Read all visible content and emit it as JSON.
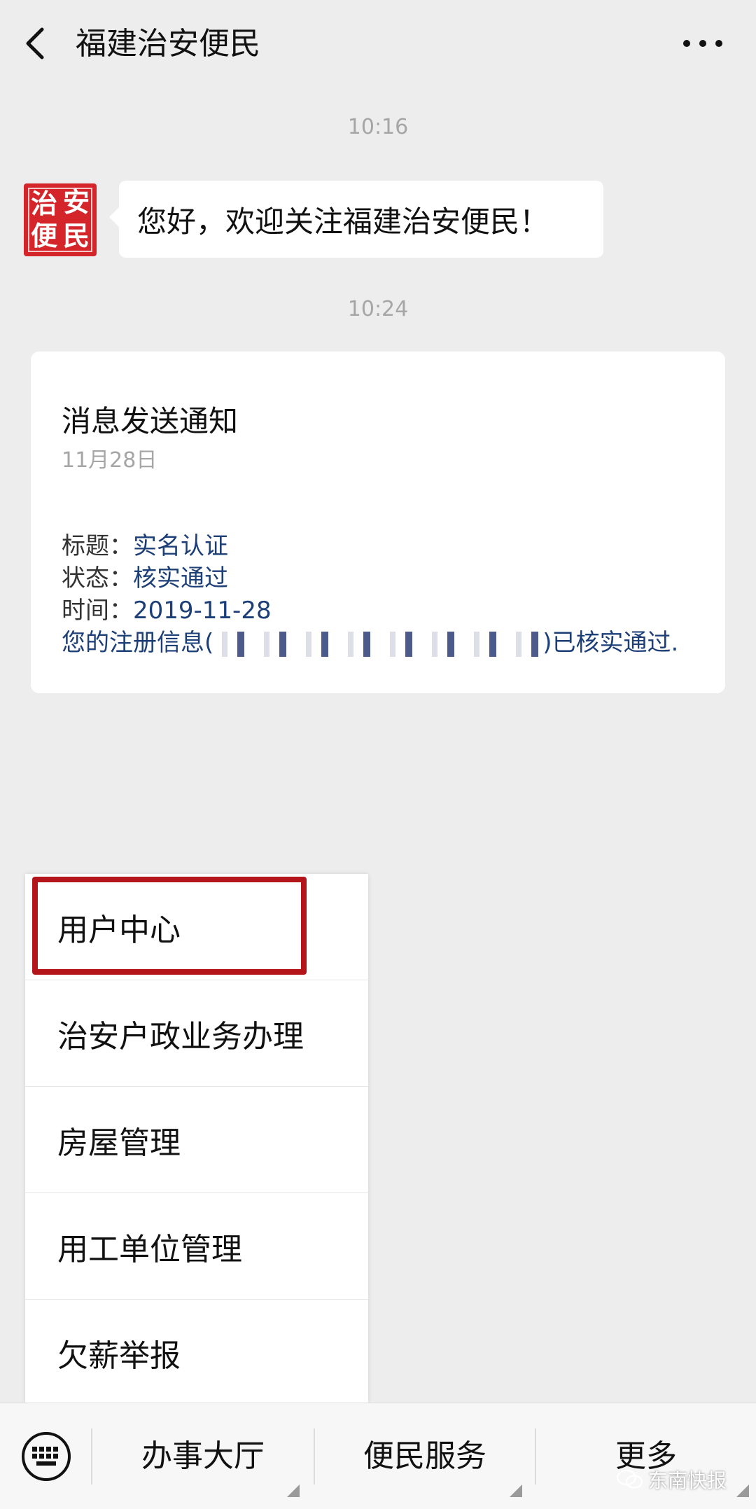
{
  "header": {
    "title": "福建治安便民"
  },
  "chat": {
    "time1": "10:16",
    "avatar_chars": [
      "治",
      "安",
      "便",
      "民"
    ],
    "greeting": "您好，欢迎关注福建治安便民！",
    "time2": "10:24",
    "card": {
      "title": "消息发送通知",
      "date": "11月28日",
      "rows": [
        {
          "label": "标题：",
          "value": "实名认证"
        },
        {
          "label": "状态：",
          "value": "核实通过"
        },
        {
          "label": "时间：",
          "value": "2019-11-28"
        }
      ],
      "message_prefix": "您的注册信息(",
      "message_suffix": ")已核实通过."
    }
  },
  "menu": {
    "items": [
      "用户中心",
      "治安户政业务办理",
      "房屋管理",
      "用工单位管理",
      "欠薪举报"
    ],
    "highlight_color": "#b3151b"
  },
  "bottom_bar": {
    "tabs": [
      "办事大厅",
      "便民服务",
      "更多"
    ]
  },
  "watermark": {
    "text": "东南快报"
  }
}
